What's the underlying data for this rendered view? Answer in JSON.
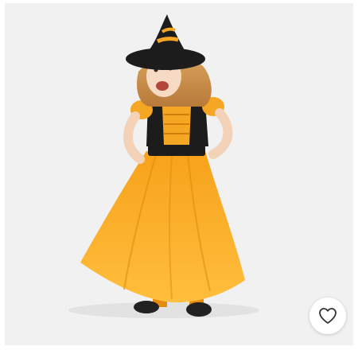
{
  "product_card": {
    "image_icon": "witch-costume-photo",
    "favorite_icon": "heart-outline-icon"
  },
  "colors": {
    "background": "#f1f1f1",
    "costume_orange": "#f5a623",
    "costume_black": "#1c1c1c",
    "heart_stroke": "#333333"
  }
}
